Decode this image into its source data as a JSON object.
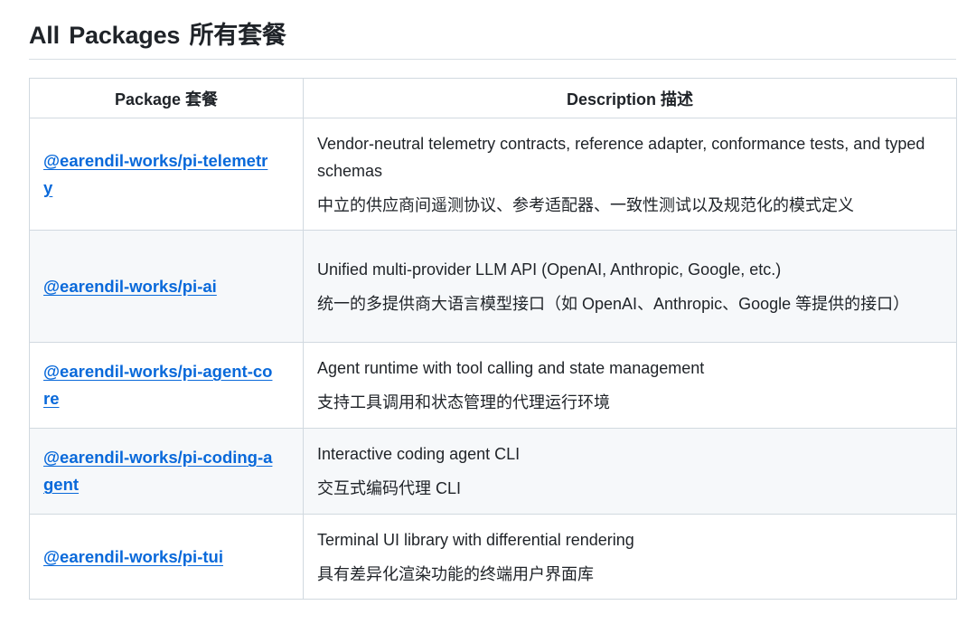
{
  "page": {
    "heading": "All Packages  所有套餐"
  },
  "table": {
    "headers": [
      "Package  套餐",
      "Description  描述"
    ],
    "rows": [
      {
        "package": "@earendil-works/pi-telemetry",
        "description_en": "Vendor-neutral telemetry contracts, reference adapter, conformance tests, and typed schemas",
        "description_zh": "中立的供应商间遥测协议、参考适配器、一致性测试以及规范化的模式定义"
      },
      {
        "package": "@earendil-works/pi-ai",
        "description_en": "Unified multi-provider LLM API (OpenAI, Anthropic, Google, etc.)",
        "description_zh": "统一的多提供商大语言模型接口（如 OpenAI、Anthropic、Google 等提供的接口）"
      },
      {
        "package": "@earendil-works/pi-agent-core",
        "description_en": "Agent runtime with tool calling and state management",
        "description_zh": "支持工具调用和状态管理的代理运行环境"
      },
      {
        "package": "@earendil-works/pi-coding-agent",
        "description_en": "Interactive coding agent CLI",
        "description_zh": "交互式编码代理 CLI"
      },
      {
        "package": "@earendil-works/pi-tui",
        "description_en": "Terminal UI library with differential rendering",
        "description_zh": "具有差异化渲染功能的终端用户界面库"
      }
    ]
  }
}
